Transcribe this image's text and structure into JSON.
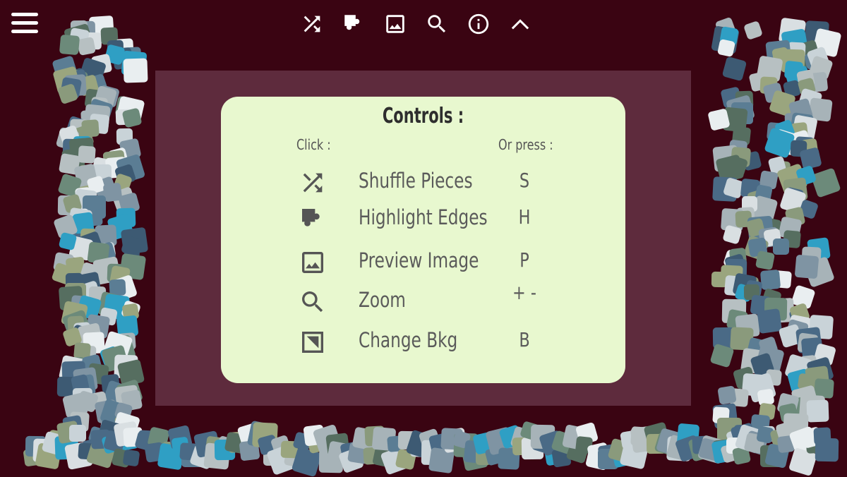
{
  "colors": {
    "background": "#3a0412",
    "board": "#5e2b3d",
    "panel": "#e8f8cf",
    "icon_light": "#ffffff",
    "icon_dark": "#555555"
  },
  "toolbar": {
    "menu_icon": "hamburger-menu-icon",
    "buttons": [
      {
        "name": "shuffle",
        "icon": "shuffle-icon"
      },
      {
        "name": "highlight-edges",
        "icon": "puzzle-edge-icon"
      },
      {
        "name": "preview-image",
        "icon": "image-icon"
      },
      {
        "name": "zoom",
        "icon": "magnifier-icon"
      },
      {
        "name": "info",
        "icon": "info-icon"
      },
      {
        "name": "collapse",
        "icon": "chevron-up-icon"
      }
    ]
  },
  "controls": {
    "title": "Controls :",
    "click_header": "Click :",
    "press_header": "Or press :",
    "rows": [
      {
        "icon": "shuffle-icon",
        "label": "Shuffle Pieces",
        "key": "S"
      },
      {
        "icon": "puzzle-edge-icon",
        "label": "Highlight Edges",
        "key": "H"
      },
      {
        "icon": "image-icon",
        "label": "Preview Image",
        "key": "P"
      },
      {
        "icon": "magnifier-icon",
        "label": "Zoom",
        "key": "+ -"
      },
      {
        "icon": "background-icon",
        "label": "Change Bkg",
        "key": "B"
      }
    ]
  }
}
